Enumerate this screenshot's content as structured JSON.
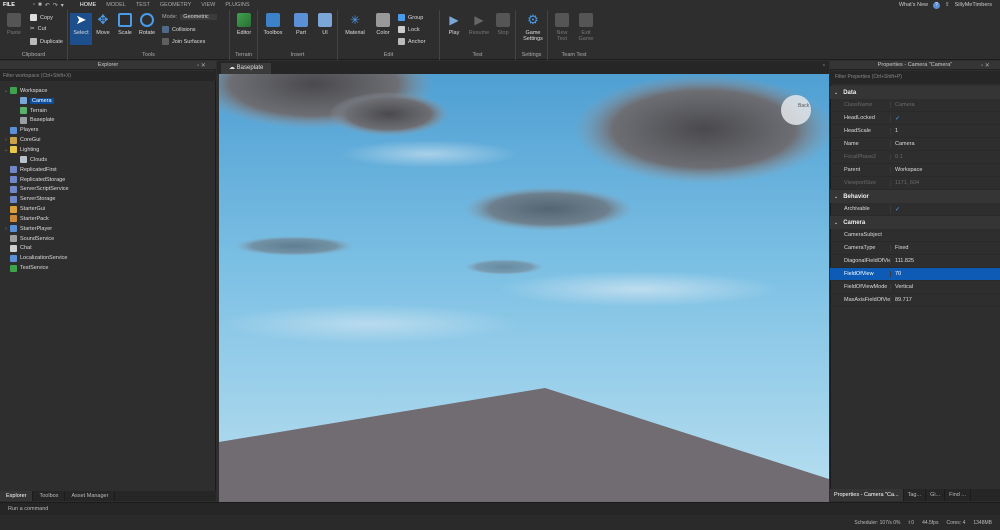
{
  "menubar": {
    "file_label": "FILE",
    "tabs": [
      "HOME",
      "MODEL",
      "TEST",
      "GEOMETRY",
      "VIEW",
      "PLUGINS"
    ],
    "active_tab": "HOME",
    "whats_new": "What's New",
    "username": "SillyMeTimbers"
  },
  "ribbon": {
    "clipboard": {
      "paste": "Paste",
      "copy": "Copy",
      "cut": "Cut",
      "duplicate": "Duplicate",
      "label": "Clipboard"
    },
    "tools": {
      "select": "Select",
      "move": "Move",
      "scale": "Scale",
      "rotate": "Rotate",
      "mode_label": "Mode:",
      "mode_value": "Geometric",
      "collisions": "Collisions",
      "join_surfaces": "Join Surfaces",
      "label": "Tools"
    },
    "terrain": {
      "editor": "Editor",
      "label": "Terrain"
    },
    "insert": {
      "toolbox": "Toolbox",
      "part": "Part",
      "ui": "UI",
      "label": "Insert"
    },
    "edit": {
      "material": "Material",
      "color": "Color",
      "group": "Group",
      "lock": "Lock",
      "anchor": "Anchor",
      "label": "Edit"
    },
    "test": {
      "play": "Play",
      "resume": "Resume",
      "stop": "Stop",
      "label": "Test"
    },
    "settings": {
      "game_settings": "Game Settings",
      "label": "Settings"
    },
    "team_test": {
      "new_test": "New Test",
      "exit_game": "Exit Game",
      "label": "Team Test"
    }
  },
  "explorer": {
    "title": "Explorer",
    "filter_placeholder": "Filter workspace (Ctrl+Shift+X)",
    "items": [
      {
        "label": "Workspace",
        "indent": 0,
        "expander": "v",
        "icon_color": "#3fa34d",
        "selected": false
      },
      {
        "label": "Camera",
        "indent": 1,
        "expander": "",
        "icon_color": "#7aa7d8",
        "selected": true
      },
      {
        "label": "Terrain",
        "indent": 1,
        "expander": "",
        "icon_color": "#5bb06b",
        "selected": false
      },
      {
        "label": "Baseplate",
        "indent": 1,
        "expander": "",
        "icon_color": "#9aa0a6",
        "selected": false
      },
      {
        "label": "Players",
        "indent": 0,
        "expander": "",
        "icon_color": "#5b8fd6",
        "selected": false
      },
      {
        "label": "CoreGui",
        "indent": 0,
        "expander": ">",
        "icon_color": "#c9a24a",
        "selected": false
      },
      {
        "label": "Lighting",
        "indent": 0,
        "expander": "v",
        "icon_color": "#e8c84a",
        "selected": false
      },
      {
        "label": "Clouds",
        "indent": 1,
        "expander": "",
        "icon_color": "#b9c3cc",
        "selected": false
      },
      {
        "label": "ReplicatedFirst",
        "indent": 0,
        "expander": "",
        "icon_color": "#7088c8",
        "selected": false
      },
      {
        "label": "ReplicatedStorage",
        "indent": 0,
        "expander": "",
        "icon_color": "#7088c8",
        "selected": false
      },
      {
        "label": "ServerScriptService",
        "indent": 0,
        "expander": "",
        "icon_color": "#7088c8",
        "selected": false
      },
      {
        "label": "ServerStorage",
        "indent": 0,
        "expander": "",
        "icon_color": "#7088c8",
        "selected": false
      },
      {
        "label": "StarterGui",
        "indent": 0,
        "expander": "",
        "icon_color": "#d9a03c",
        "selected": false
      },
      {
        "label": "StarterPack",
        "indent": 0,
        "expander": "",
        "icon_color": "#c98a3c",
        "selected": false
      },
      {
        "label": "StarterPlayer",
        "indent": 0,
        "expander": ">",
        "icon_color": "#5b8fd6",
        "selected": false
      },
      {
        "label": "SoundService",
        "indent": 0,
        "expander": "",
        "icon_color": "#a0a0a0",
        "selected": false
      },
      {
        "label": "Chat",
        "indent": 0,
        "expander": "",
        "icon_color": "#d0d0d0",
        "selected": false
      },
      {
        "label": "LocalizationService",
        "indent": 0,
        "expander": "",
        "icon_color": "#5b8fd6",
        "selected": false
      },
      {
        "label": "TestService",
        "indent": 0,
        "expander": "",
        "icon_color": "#3fa34d",
        "selected": false
      }
    ],
    "bottom_tabs": [
      "Explorer",
      "Toolbox",
      "Asset Manager"
    ]
  },
  "viewport": {
    "tab_label": "Baseplate",
    "view_cube_label": "Back"
  },
  "properties": {
    "title": "Properties - Camera \"Camera\"",
    "filter_placeholder": "Filter Properties (Ctrl+Shift+P)",
    "sections": [
      {
        "name": "Data",
        "rows": [
          {
            "name": "ClassName",
            "value": "Camera",
            "disabled": true,
            "check": false,
            "selected": false
          },
          {
            "name": "HeadLocked",
            "value": "",
            "disabled": false,
            "check": true,
            "selected": false
          },
          {
            "name": "HeadScale",
            "value": "1",
            "disabled": false,
            "check": false,
            "selected": false
          },
          {
            "name": "Name",
            "value": "Camera",
            "disabled": false,
            "check": false,
            "selected": false
          },
          {
            "name": "FocalPhase2",
            "value": "0.1",
            "disabled": true,
            "check": false,
            "selected": false
          },
          {
            "name": "Parent",
            "value": "Workspace",
            "disabled": false,
            "check": false,
            "selected": false
          },
          {
            "name": "ViewportSize",
            "value": "1171, 604",
            "disabled": true,
            "check": false,
            "selected": false
          }
        ]
      },
      {
        "name": "Behavior",
        "rows": [
          {
            "name": "Archivable",
            "value": "",
            "disabled": false,
            "check": true,
            "selected": false
          }
        ]
      },
      {
        "name": "Camera",
        "rows": [
          {
            "name": "CameraSubject",
            "value": "",
            "disabled": false,
            "check": false,
            "selected": false
          },
          {
            "name": "CameraType",
            "value": "Fixed",
            "disabled": false,
            "check": false,
            "selected": false
          },
          {
            "name": "DiagonalFieldOfView",
            "value": "111.825",
            "disabled": false,
            "check": false,
            "selected": false
          },
          {
            "name": "FieldOfView",
            "value": "70",
            "disabled": false,
            "check": false,
            "selected": true
          },
          {
            "name": "FieldOfViewMode",
            "value": "Vertical",
            "disabled": false,
            "check": false,
            "selected": false
          },
          {
            "name": "MaxAxisFieldOfView",
            "value": "89.717",
            "disabled": false,
            "check": false,
            "selected": false
          }
        ]
      }
    ],
    "bottom_tabs": [
      "Properties - Camera \"Ca...",
      "Tag...",
      "Gi...",
      "Find ..."
    ]
  },
  "command_bar": {
    "placeholder": "Run a command"
  },
  "status_bar": {
    "scheduler": "Scheduler: 107/s 0%",
    "t": "t 0",
    "fps": "44.5fps",
    "cores": "Cores: 4",
    "memory": "1348MB"
  },
  "colors": {
    "accent": "#0e5bb5",
    "selection": "#0e4d9a",
    "sky_top": "#5ea7d4",
    "ground": "#716b72"
  }
}
